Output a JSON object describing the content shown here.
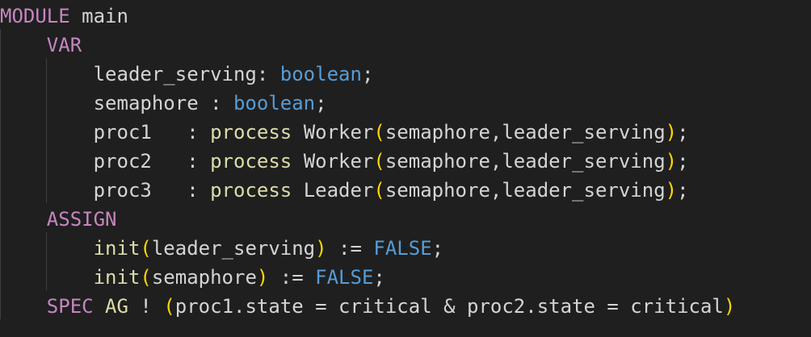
{
  "code": {
    "lines": [
      {
        "name": "line-1",
        "tokens": [
          {
            "t": "MODULE",
            "c": "kw"
          },
          {
            "t": " main",
            "c": "plain"
          }
        ]
      },
      {
        "name": "line-2",
        "tokens": [
          {
            "t": "    ",
            "c": "plain"
          },
          {
            "t": "VAR",
            "c": "kw"
          }
        ]
      },
      {
        "name": "line-3",
        "tokens": [
          {
            "t": "        leader_serving: ",
            "c": "plain"
          },
          {
            "t": "boolean",
            "c": "type"
          },
          {
            "t": ";",
            "c": "plain"
          }
        ]
      },
      {
        "name": "line-4",
        "tokens": [
          {
            "t": "        semaphore : ",
            "c": "plain"
          },
          {
            "t": "boolean",
            "c": "type"
          },
          {
            "t": ";",
            "c": "plain"
          }
        ]
      },
      {
        "name": "line-5",
        "tokens": [
          {
            "t": "        proc1   : ",
            "c": "plain"
          },
          {
            "t": "process",
            "c": "fn"
          },
          {
            "t": " Worker",
            "c": "plain"
          },
          {
            "t": "(",
            "c": "paren"
          },
          {
            "t": "semaphore,leader_serving",
            "c": "plain"
          },
          {
            "t": ")",
            "c": "paren"
          },
          {
            "t": ";",
            "c": "plain"
          }
        ]
      },
      {
        "name": "line-6",
        "tokens": [
          {
            "t": "        proc2   : ",
            "c": "plain"
          },
          {
            "t": "process",
            "c": "fn"
          },
          {
            "t": " Worker",
            "c": "plain"
          },
          {
            "t": "(",
            "c": "paren"
          },
          {
            "t": "semaphore,leader_serving",
            "c": "plain"
          },
          {
            "t": ")",
            "c": "paren"
          },
          {
            "t": ";",
            "c": "plain"
          }
        ]
      },
      {
        "name": "line-7",
        "tokens": [
          {
            "t": "        proc3   : ",
            "c": "plain"
          },
          {
            "t": "process",
            "c": "fn"
          },
          {
            "t": " Leader",
            "c": "plain"
          },
          {
            "t": "(",
            "c": "paren"
          },
          {
            "t": "semaphore,leader_serving",
            "c": "plain"
          },
          {
            "t": ")",
            "c": "paren"
          },
          {
            "t": ";",
            "c": "plain"
          }
        ]
      },
      {
        "name": "line-8",
        "tokens": [
          {
            "t": "    ",
            "c": "plain"
          },
          {
            "t": "ASSIGN",
            "c": "kw"
          }
        ]
      },
      {
        "name": "line-9",
        "tokens": [
          {
            "t": "        ",
            "c": "plain"
          },
          {
            "t": "init",
            "c": "fn"
          },
          {
            "t": "(",
            "c": "paren"
          },
          {
            "t": "leader_serving",
            "c": "plain"
          },
          {
            "t": ")",
            "c": "paren"
          },
          {
            "t": " := ",
            "c": "plain"
          },
          {
            "t": "FALSE",
            "c": "type"
          },
          {
            "t": ";",
            "c": "plain"
          }
        ]
      },
      {
        "name": "line-10",
        "tokens": [
          {
            "t": "        ",
            "c": "plain"
          },
          {
            "t": "init",
            "c": "fn"
          },
          {
            "t": "(",
            "c": "paren"
          },
          {
            "t": "semaphore",
            "c": "plain"
          },
          {
            "t": ")",
            "c": "paren"
          },
          {
            "t": " := ",
            "c": "plain"
          },
          {
            "t": "FALSE",
            "c": "type"
          },
          {
            "t": ";",
            "c": "plain"
          }
        ]
      },
      {
        "name": "line-11",
        "tokens": [
          {
            "t": "    ",
            "c": "plain"
          },
          {
            "t": "SPEC",
            "c": "kw"
          },
          {
            "t": " ",
            "c": "plain"
          },
          {
            "t": "AG",
            "c": "fn"
          },
          {
            "t": " ! ",
            "c": "plain"
          },
          {
            "t": "(",
            "c": "paren"
          },
          {
            "t": "proc1.state = critical & proc2.state = critical",
            "c": "plain"
          },
          {
            "t": ")",
            "c": "paren"
          }
        ]
      }
    ]
  },
  "colors": {
    "background": "#1f1f1f",
    "keyword": "#c586c0",
    "type": "#569cd6",
    "function": "#dcdcaa",
    "bracket": "#ffd700",
    "text": "#d4d4d4"
  }
}
